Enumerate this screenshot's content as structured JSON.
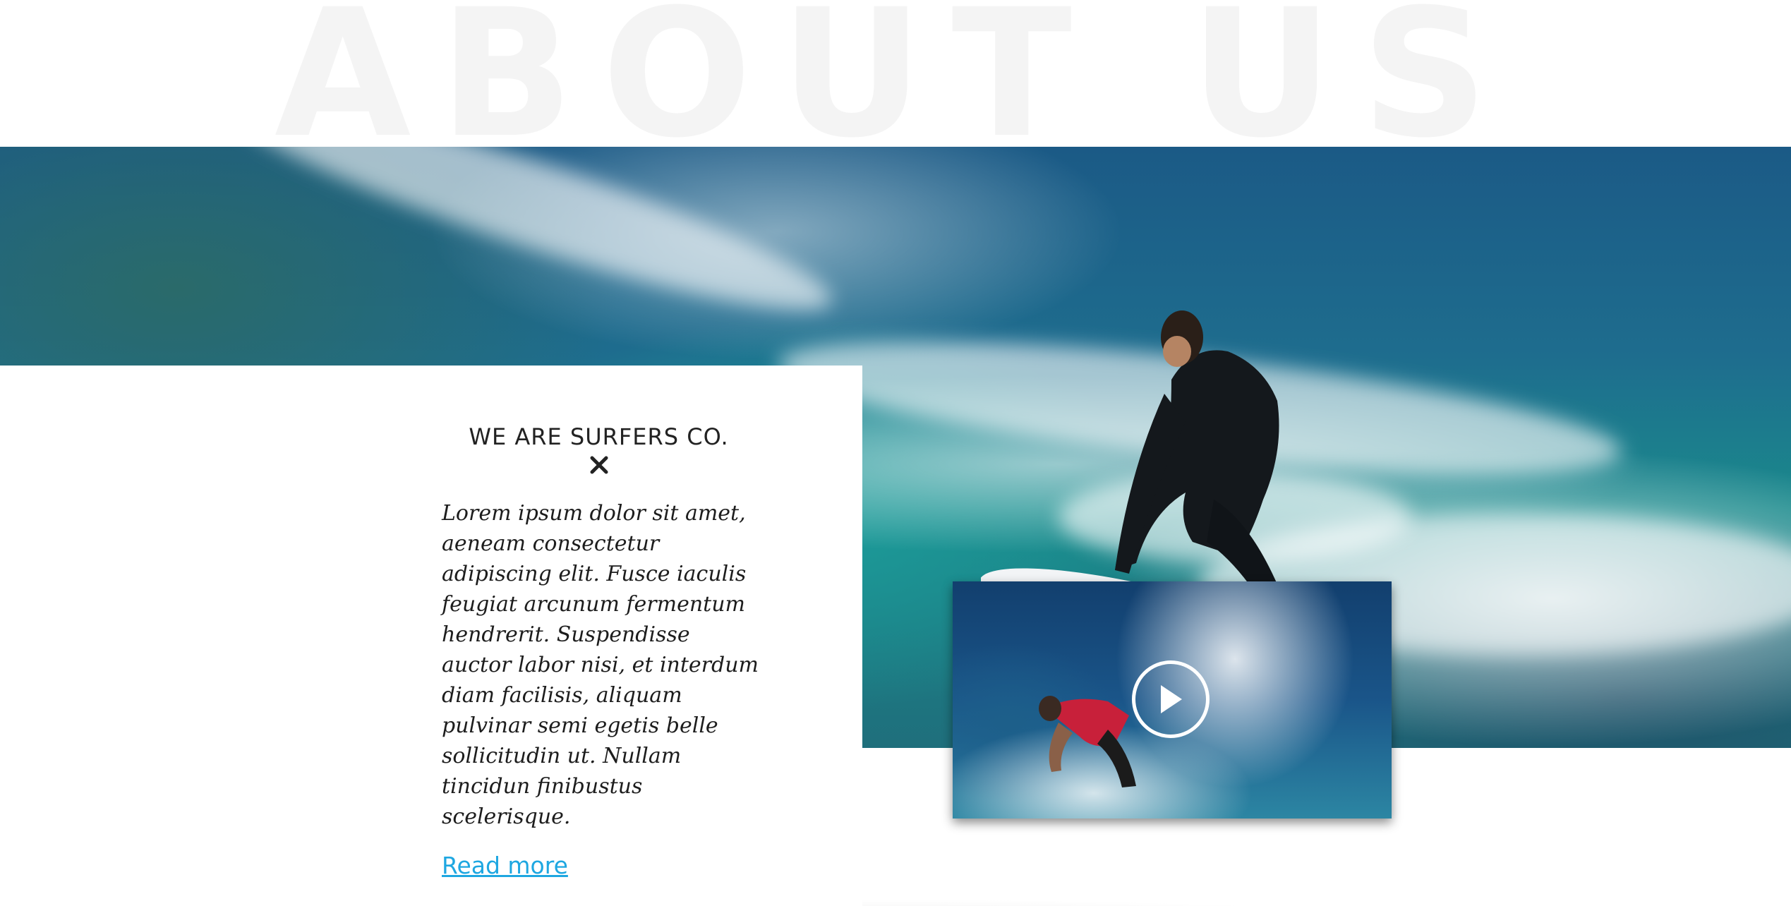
{
  "section": {
    "background_title": "ABOUT US"
  },
  "content": {
    "heading": "WE ARE SURFERS CO.",
    "divider_icon": "cross-icon",
    "body": "Lorem ipsum dolor sit amet, aeneam consectetur adipiscing elit. Fusce iaculis feugiat arcunum fermentum hendrerit. Suspendisse auctor labor nisi, et interdum diam facilisis, aliquam pulvinar semi egetis belle sollicitudin ut. Nullam tincidun finibustus scelerisque.",
    "read_more_label": "Read more"
  },
  "media": {
    "hero_image": "surfer-on-wave-photo",
    "video_thumbnail": "surfer-video-thumbnail",
    "play_icon": "play-icon"
  },
  "colors": {
    "accent_link": "#1ea7e1",
    "heading_text": "#222222",
    "background_title": "#f4f4f4"
  }
}
